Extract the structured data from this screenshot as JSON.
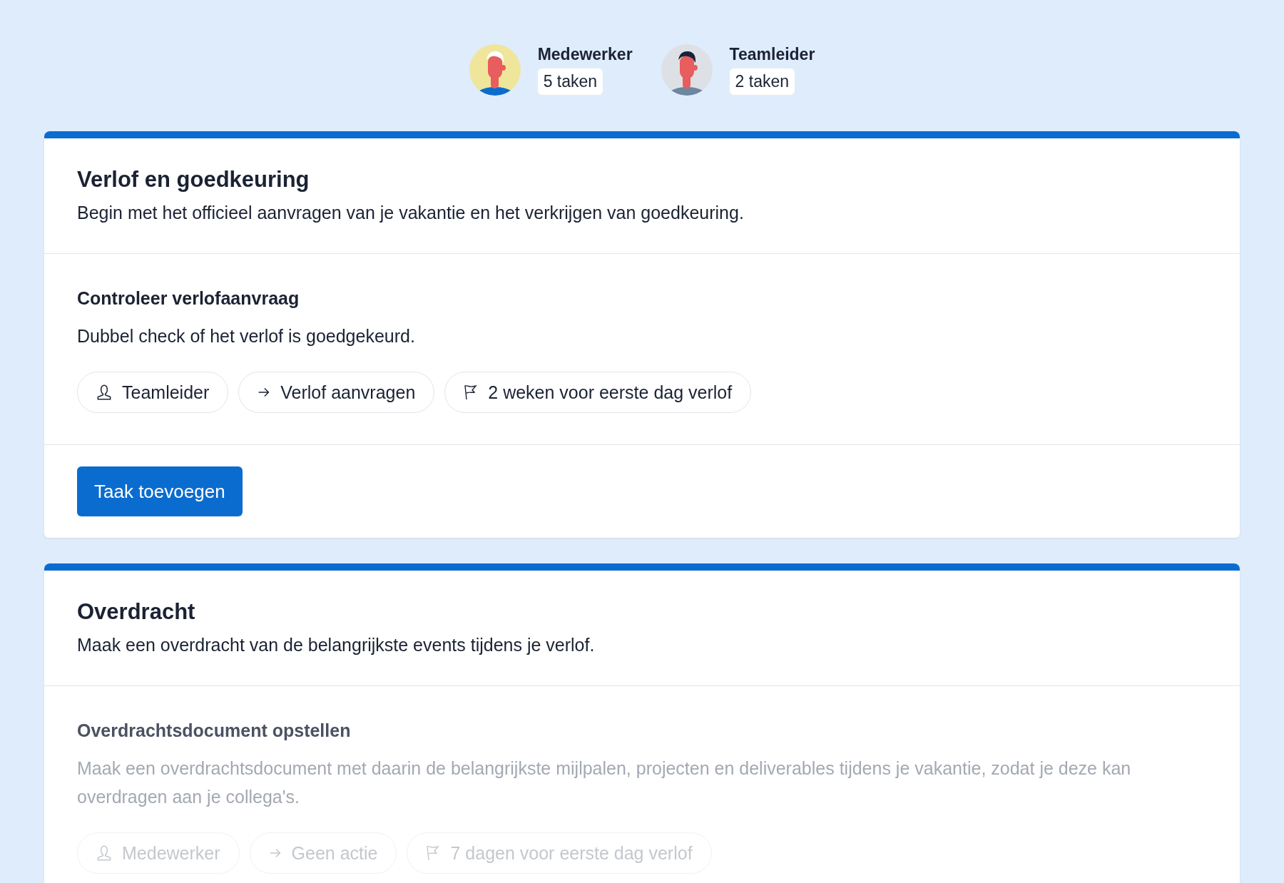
{
  "assignees": [
    {
      "name": "Medewerker",
      "count": "5 taken",
      "kind": "employee"
    },
    {
      "name": "Teamleider",
      "count": "2 taken",
      "kind": "lead"
    }
  ],
  "sections": [
    {
      "title": "Verlof en goedkeuring",
      "description": "Begin met het officieel aanvragen van je vakantie en het verkrijgen van goedkeuring.",
      "tasks": [
        {
          "title": "Controleer verlofaanvraag",
          "description": "Dubbel check of het verlof is goedgekeurd.",
          "disabled": false,
          "chips": [
            {
              "kind": "person",
              "label": "Teamleider"
            },
            {
              "kind": "action",
              "label": "Verlof aanvragen"
            },
            {
              "kind": "deadline",
              "label": "2 weken voor eerste dag verlof"
            }
          ]
        }
      ],
      "add_button": "Taak toevoegen"
    },
    {
      "title": "Overdracht",
      "description": "Maak een overdracht van de belangrijkste events tijdens je verlof.",
      "tasks": [
        {
          "title": "Overdrachtsdocument opstellen",
          "description": "Maak een overdrachtsdocument met daarin de belangrijkste mijlpalen, projecten en deliverables tijdens je vakantie, zodat je deze kan overdragen aan je collega's.",
          "disabled": true,
          "chips": [
            {
              "kind": "person",
              "label": "Medewerker"
            },
            {
              "kind": "action",
              "label": "Geen actie"
            },
            {
              "kind": "deadline",
              "label": "7 dagen voor eerste dag verlof"
            }
          ]
        }
      ]
    }
  ]
}
